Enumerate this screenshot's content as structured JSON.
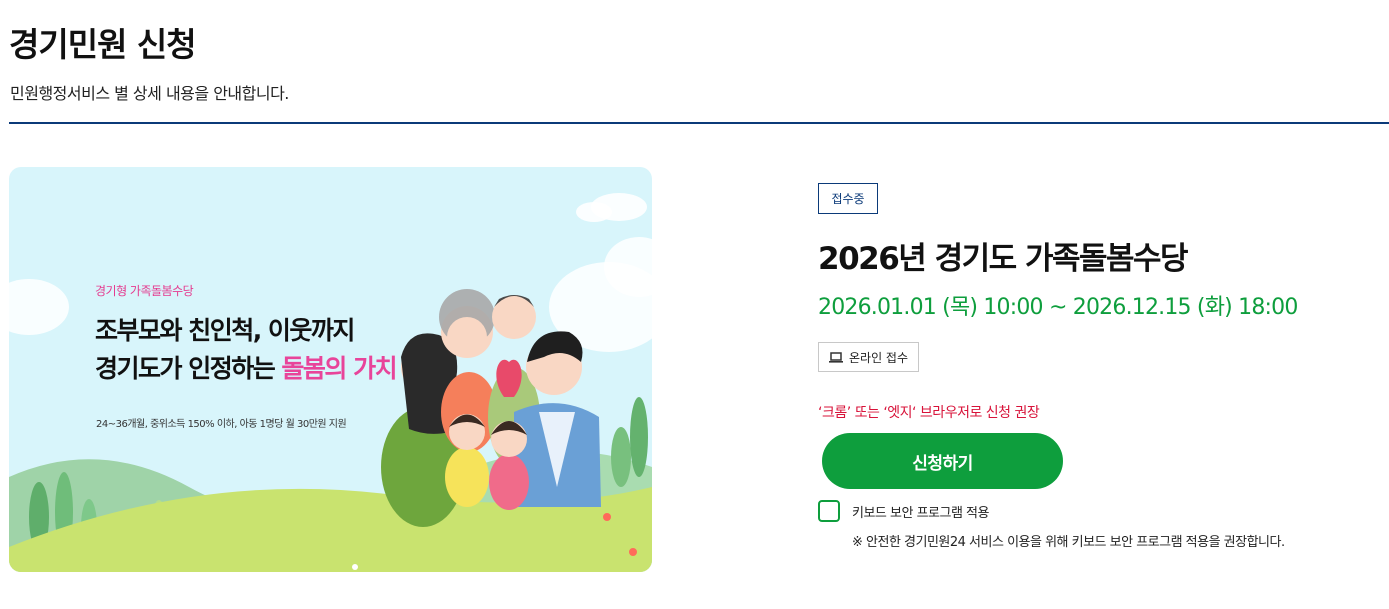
{
  "header": {
    "title": "경기민원 신청",
    "subtitle": "민원행정서비스 별 상세 내용을 안내합니다."
  },
  "banner": {
    "tag": "경기형 가족돌봄수당",
    "headline_line1": "조부모와 친인척, 이웃까지",
    "headline_line2_prefix": "경기도가 인정하는 ",
    "headline_line2_highlight": "돌봄의 가치",
    "note": "24~36개월, 중위소득 150% 이하, 아동 1명당 월 30만원 지원"
  },
  "service": {
    "status": "접수중",
    "title": "2026년 경기도 가족돌봄수당",
    "period": "2026.01.01 (목) 10:00 ~ 2026.12.15 (화) 18:00",
    "channel": "온라인 접수",
    "channel_icon": "laptop-icon",
    "browser_note": "‘크롬’ 또는 ‘엣지‘ 브라우저로 신청 권장",
    "apply_label": "신청하기",
    "keyboard_label": "키보드 보안 프로그램 적용",
    "keyboard_note": "※ 안전한 경기민원24 서비스 이용을 위해 키보드 보안 프로그램 적용을 권장합니다."
  },
  "colors": {
    "primary_navy": "#0b3a79",
    "accent_green": "#0e9e3d",
    "warning_red": "#d8133a",
    "banner_pink": "#e8449a"
  }
}
